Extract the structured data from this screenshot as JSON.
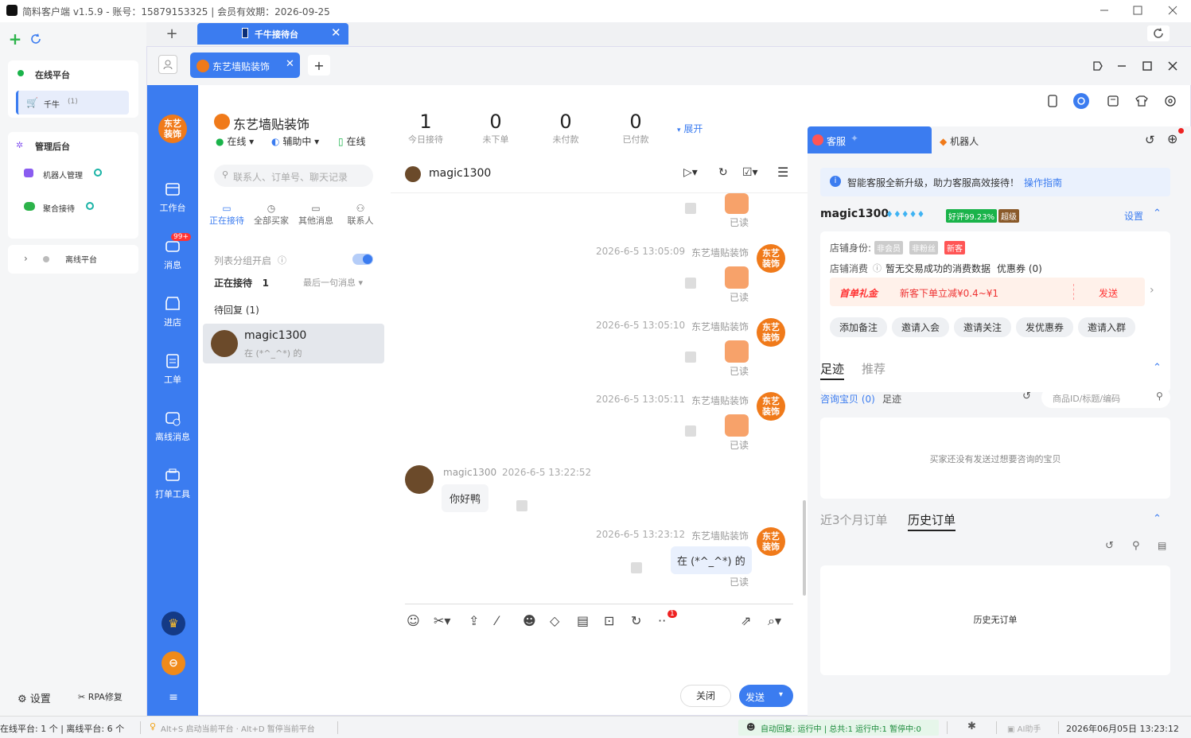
{
  "titlebar": {
    "title": "简料客户端 v1.5.9 - 账号：15879153325 | 会员有效期：2026-09-25"
  },
  "appside": {
    "online_platform": "在线平台",
    "qianniu": "千牛",
    "qianniu_count": "(1)",
    "admin": "管理后台",
    "robot_mgmt": "机器人管理",
    "aggregate": "聚合接待",
    "offline_platform": "离线平台",
    "settings": "设置",
    "rpa_fix": "RPA修复"
  },
  "apptabs": {
    "active": "千牛接待台"
  },
  "inner_tabs": {
    "shop_tab": "东艺墙贴装饰"
  },
  "bluebar": {
    "logo": "东艺\n装饰",
    "items": [
      "工作台",
      "消息",
      "进店",
      "工单",
      "离线消息",
      "打单工具"
    ],
    "badge": "99+"
  },
  "shop": {
    "name": "东艺墙贴装饰",
    "online": "在线",
    "assist": "辅助中",
    "online2": "在线"
  },
  "stats": [
    {
      "value": "1",
      "label": "今日接待"
    },
    {
      "value": "0",
      "label": "未下单"
    },
    {
      "value": "0",
      "label": "未付款"
    },
    {
      "value": "0",
      "label": "已付款"
    }
  ],
  "expand": "展开",
  "list": {
    "search_placeholder": "联系人、订单号、聊天记录",
    "tabs": [
      "正在接待",
      "全部买家",
      "其他消息",
      "联系人"
    ],
    "group_toggle": "列表分组开启",
    "receiving": "正在接待",
    "receiving_count": "1",
    "sort": "最后一句消息",
    "pending": "待回复 (1)",
    "contact_name": "magic1300",
    "contact_preview": "在 (*^_^*) 的"
  },
  "chat": {
    "contact": "magic1300",
    "shop_name": "东艺墙贴装饰",
    "read": "已读",
    "messages": [
      {
        "time": "2026-6-5 13:05:09"
      },
      {
        "time": "2026-6-5 13:05:10"
      },
      {
        "time": "2026-6-5 13:05:11"
      }
    ],
    "buyer_name": "magic1300",
    "buyer_time": "2026-6-5 13:22:52",
    "buyer_text": "你好鸭",
    "seller_time": "2026-6-5 13:23:12",
    "seller_text": "在 (*^_^*) 的",
    "close": "关闭",
    "send": "发送",
    "tool_badge": "1"
  },
  "right": {
    "tab_service": "客服",
    "tab_robot": "机器人",
    "notice": "智能客服全新升级，助力客服高效接待！",
    "guide": "操作指南",
    "user": "magic1300",
    "praise": "好评99.23%",
    "level": "超级",
    "settings": "设置",
    "identity_label": "店铺身份:",
    "tags": [
      "非会员",
      "非粉丝",
      "新客"
    ],
    "consume_label": "店铺消费",
    "consume_text": "暂无交易成功的消费数据",
    "coupon": "优惠券 (0)",
    "gift": "首单礼金",
    "gift_text": "新客下单立减¥0.4~¥1",
    "gift_send": "发送",
    "actions": [
      "添加备注",
      "邀请入会",
      "邀请关注",
      "发优惠券",
      "邀请入群"
    ],
    "foot_tab": "足迹",
    "recommend_tab": "推荐",
    "consult": "咨询宝贝 (0)",
    "footprint": "足迹",
    "goods_placeholder": "商品ID/标题/编码",
    "no_goods": "买家还没有发送过想要咨询的宝贝",
    "orders_3m": "近3个月订单",
    "history_orders": "历史订单",
    "no_orders": "历史无订单"
  },
  "status": {
    "platforms": "在线平台: 1 个 | 离线平台: 6 个",
    "hint": "Alt+S 启动当前平台 · Alt+D 暂停当前平台",
    "auto_reply": "自动回复: 运行中 | 总共:1 运行中:1 暂停中:0",
    "ai": "AI助手",
    "datetime": "2026年06月05日 13:23:12"
  }
}
